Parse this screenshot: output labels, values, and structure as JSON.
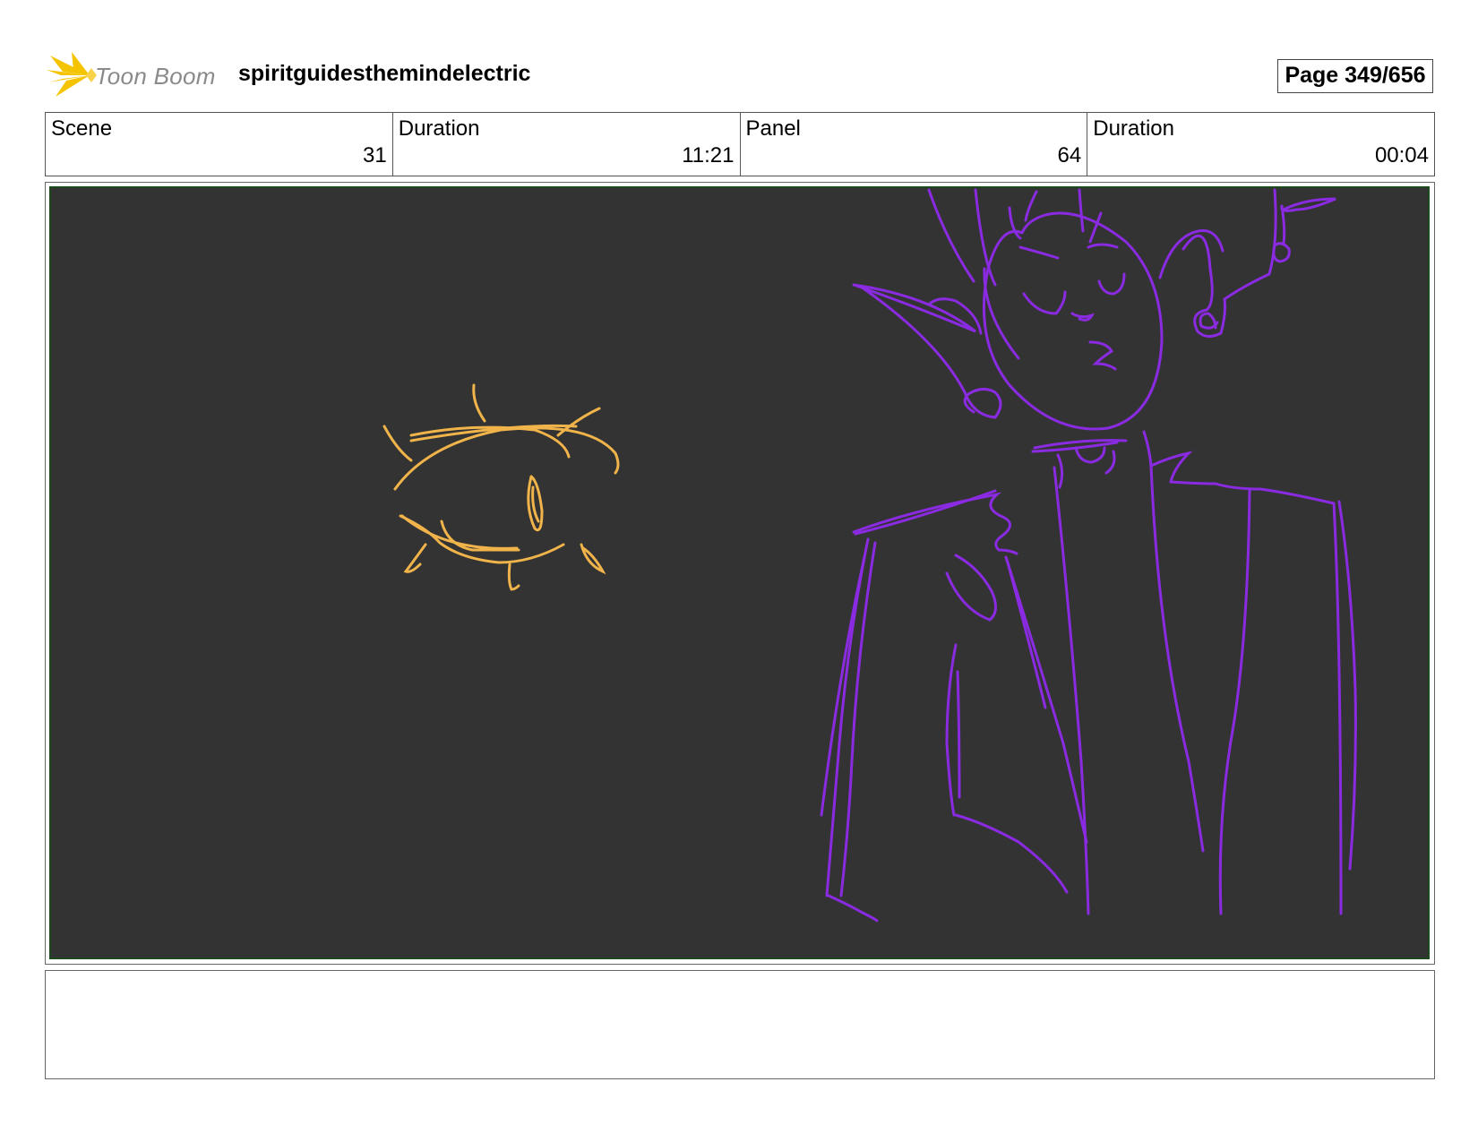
{
  "header": {
    "logo_text": "Toon Boom",
    "project_title": "spiritguidesthemindelectric",
    "page_label": "Page 349/656"
  },
  "info": {
    "scene_label": "Scene",
    "scene_value": "31",
    "scene_duration_label": "Duration",
    "scene_duration_value": "11:21",
    "panel_label": "Panel",
    "panel_value": "64",
    "panel_duration_label": "Duration",
    "panel_duration_value": "00:04"
  },
  "colors": {
    "sketch_yellow": "#f0b44a",
    "sketch_purple": "#8a2be2",
    "panel_background": "#333333",
    "logo_star": "#f5c400"
  },
  "notes": ""
}
